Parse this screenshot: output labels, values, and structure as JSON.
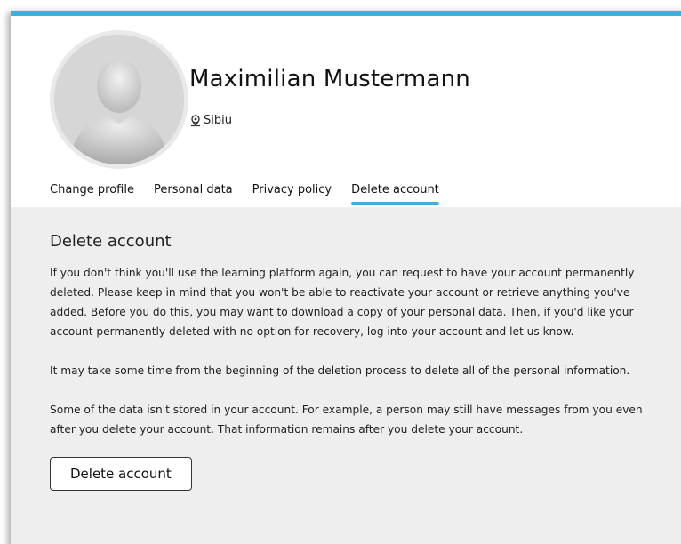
{
  "profile": {
    "name": "Maximilian Mustermann",
    "location": "Sibiu",
    "avatar_icon": "user-silhouette-icon",
    "location_icon": "map-pin-icon"
  },
  "tabs": [
    {
      "label": "Change profile",
      "active": false
    },
    {
      "label": "Personal data",
      "active": false
    },
    {
      "label": "Privacy policy",
      "active": false
    },
    {
      "label": "Delete account",
      "active": true
    }
  ],
  "main": {
    "title": "Delete account",
    "paragraphs": [
      "If you don't think you'll use the learning platform again, you can request to have your account permanently deleted. Please keep in mind that you won't be able to reactivate your account or retrieve anything you've added. Before you do this, you may want to download a copy of your personal data. Then, if you'd like your account permanently deleted with no option for recovery, log into your account and let us know.",
      "It may take some time from the beginning of the deletion process to delete all of the personal information.",
      "Some of the data isn't stored in your account. For example, a person may still have messages from you even after you delete your account. That information remains after you delete your account."
    ],
    "button_label": "Delete account"
  },
  "colors": {
    "accent": "#3ab0dc",
    "content_bg": "#eeeeee"
  }
}
